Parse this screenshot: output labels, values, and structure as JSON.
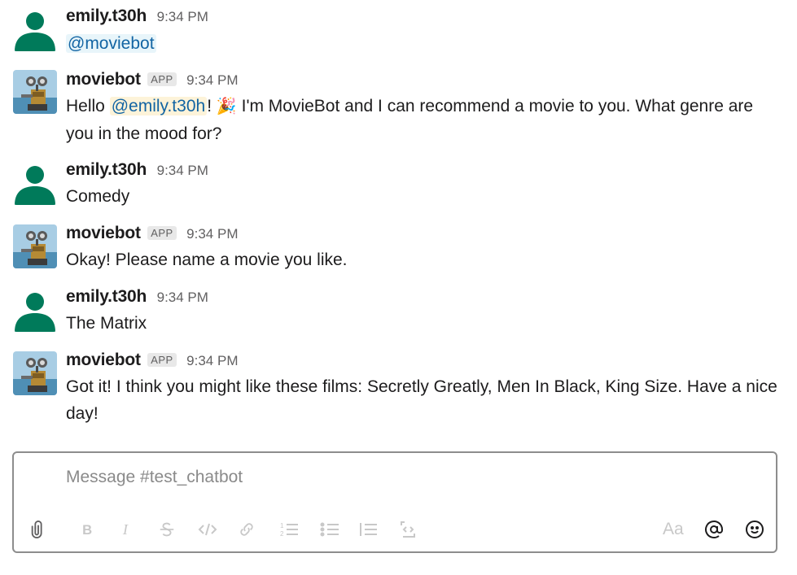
{
  "messages": [
    {
      "user": "emily.t30h",
      "time": "9:34 PM",
      "is_app": false,
      "text": "",
      "mention": "@moviebot"
    },
    {
      "user": "moviebot",
      "time": "9:34 PM",
      "is_app": true,
      "badge": "APP",
      "text_pre": "Hello ",
      "mention": "@emily.t30h",
      "text_mid": "!",
      "emoji": "🎉",
      "text_post": " I'm MovieBot and I can recommend a movie to you. What genre are you in the mood for?"
    },
    {
      "user": "emily.t30h",
      "time": "9:34 PM",
      "is_app": false,
      "text": "Comedy"
    },
    {
      "user": "moviebot",
      "time": "9:34 PM",
      "is_app": true,
      "badge": "APP",
      "text": "Okay! Please name a movie you like."
    },
    {
      "user": "emily.t30h",
      "time": "9:34 PM",
      "is_app": false,
      "text": "The Matrix"
    },
    {
      "user": "moviebot",
      "time": "9:34 PM",
      "is_app": true,
      "badge": "APP",
      "text": "Got it! I think you might like these films: Secretly Greatly, Men In Black, King Size. Have a nice day!"
    }
  ],
  "composer": {
    "placeholder": "Message #test_chatbot",
    "format_label": "Aa",
    "mention_symbol": "@",
    "icons": [
      "paperclip-icon",
      "bold-icon",
      "italic-icon",
      "strikethrough-icon",
      "code-icon",
      "link-icon",
      "ordered-list-icon",
      "bulleted-list-icon",
      "blockquote-icon",
      "code-block-icon",
      "formatting-icon",
      "mention-icon",
      "emoji-icon"
    ]
  },
  "colors": {
    "user_avatar": "#007a5a",
    "mention_text": "#1264a3",
    "self_mention_bg": "#fdf3d9"
  }
}
